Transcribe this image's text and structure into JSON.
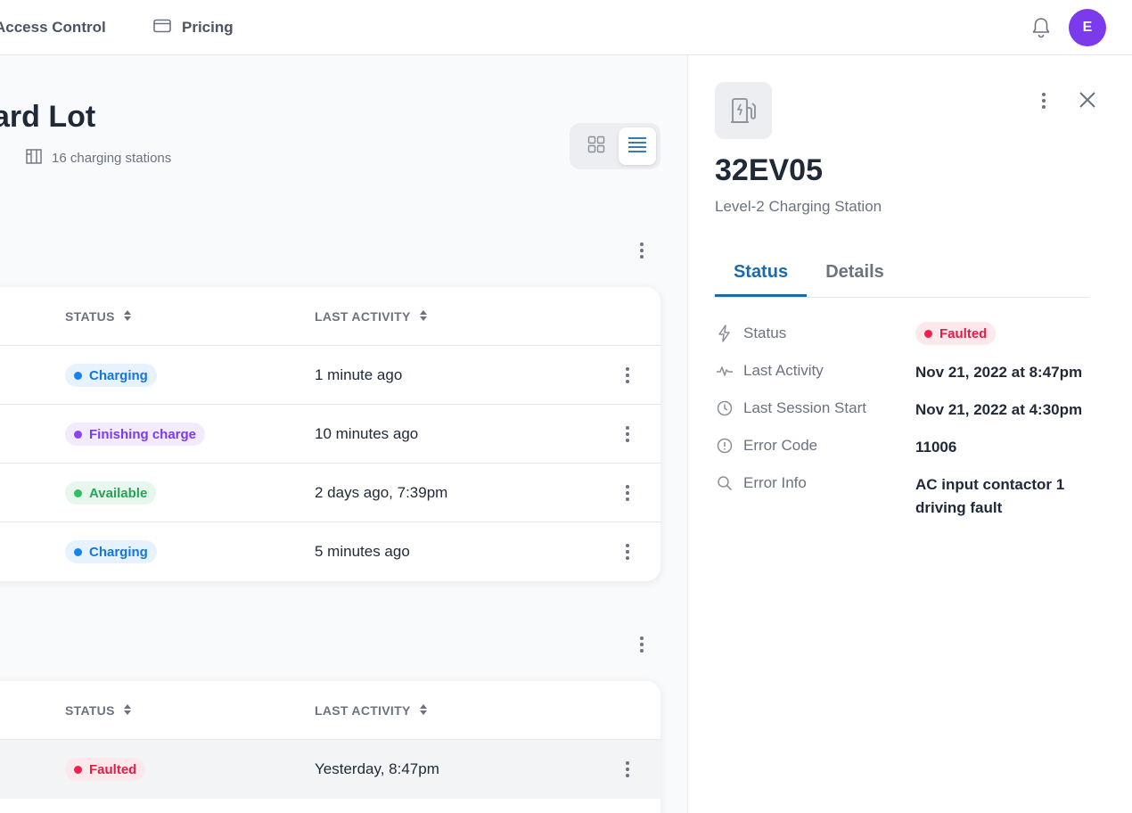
{
  "topnav": {
    "items": [
      {
        "label": "Access Control",
        "icon": "access-control-icon"
      },
      {
        "label": "Pricing",
        "icon": "credit-card-icon"
      }
    ],
    "notifications_icon": "bell-icon",
    "avatar_initial": "E"
  },
  "location": {
    "title": "ard Lot",
    "station_count_label": "16 charging stations"
  },
  "view_toggle": {
    "options": [
      "grid",
      "list"
    ],
    "selected": "list"
  },
  "table_headers": {
    "status": "STATUS",
    "last_activity": "LAST ACTIVITY"
  },
  "group1": {
    "rows": [
      {
        "status": "Charging",
        "status_key": "charging",
        "last_activity": "1 minute ago"
      },
      {
        "status": "Finishing charge",
        "status_key": "finishing",
        "last_activity": "10 minutes ago"
      },
      {
        "status": "Available",
        "status_key": "available",
        "last_activity": "2 days ago, 7:39pm"
      },
      {
        "status": "Charging",
        "status_key": "charging",
        "last_activity": "5 minutes ago"
      }
    ]
  },
  "group2": {
    "rows": [
      {
        "status": "Faulted",
        "status_key": "faulted",
        "last_activity": "Yesterday, 8:47pm",
        "selected": true
      }
    ]
  },
  "status_colors": {
    "charging": {
      "bg": "#e6f2fd",
      "fg": "#1476d6",
      "dot": "#1683f0"
    },
    "finishing": {
      "bg": "#f1ebfd",
      "fg": "#7c3aed",
      "dot": "#8b45f0"
    },
    "available": {
      "bg": "#e8f7ee",
      "fg": "#22a356",
      "dot": "#2fbf63"
    },
    "faulted": {
      "bg": "#fde8ec",
      "fg": "#e11d48",
      "dot": "#f0204f"
    }
  },
  "detail": {
    "station_id": "32EV05",
    "station_type": "Level-2 Charging Station",
    "tabs": {
      "status": "Status",
      "details": "Details"
    },
    "active_tab": "status",
    "fields": {
      "status": {
        "label": "Status",
        "value": "Faulted",
        "icon": "lightning-icon"
      },
      "last_activity": {
        "label": "Last Activity",
        "value": "Nov 21, 2022 at 8:47pm",
        "icon": "activity-pulse-icon"
      },
      "last_session_start": {
        "label": "Last Session Start",
        "value": "Nov 21, 2022 at 4:30pm",
        "icon": "clock-icon"
      },
      "error_code": {
        "label": "Error Code",
        "value": "11006",
        "icon": "alert-circle-icon"
      },
      "error_info": {
        "label": "Error Info",
        "value": "AC input contactor 1 driving fault",
        "icon": "search-icon"
      }
    }
  },
  "colors": {
    "accent": "#1d6aa8",
    "avatar": "#7c3aed"
  }
}
